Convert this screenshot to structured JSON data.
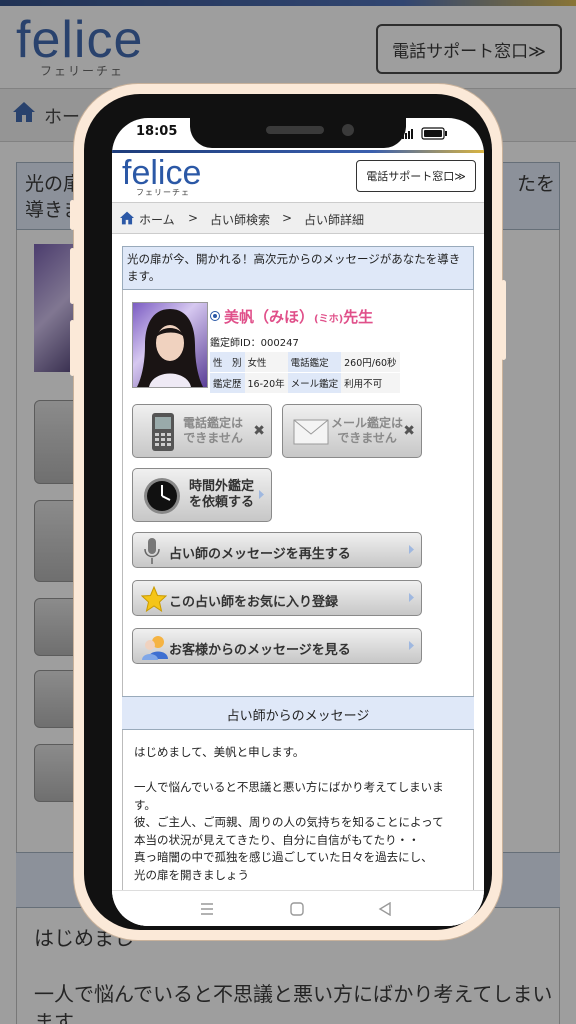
{
  "site": {
    "logo": "felice",
    "logo_sub": "フェリーチェ",
    "support_button": "電話サポート窓口≫"
  },
  "status_bar": {
    "time": "18:05"
  },
  "breadcrumb": {
    "home": "ホーム",
    "sep": ">",
    "search": "占い師検索",
    "detail": "占い師詳細",
    "bg_home": "ホー"
  },
  "intro": "光の扉が今、開かれる！高次元からのメッセージがあなたを導きます。",
  "bg": {
    "intro_left": "光の扉",
    "intro_left2": "導きま",
    "intro_right": "たを",
    "msg_line1": "はじめまし",
    "msg_line2": "一人で悩んでいると不思議と悪い方にばかり考えてしまい",
    "msg_line3": "ます。"
  },
  "profile": {
    "name": "美帆（みほ）",
    "reading": "(ミホ)",
    "title_suffix": "先生",
    "id_label": "鑑定師ID：000247",
    "rows": [
      {
        "k1": "性　別",
        "v1": "女性",
        "k2": "電話鑑定",
        "v2": "260円/60秒"
      },
      {
        "k1": "鑑定歴",
        "v1": "16-20年",
        "k2": "メール鑑定",
        "v2": "利用不可"
      }
    ]
  },
  "buttons": {
    "phone_unavailable": "電話鑑定は\nできません",
    "mail_unavailable": "メール鑑定は\nできません",
    "off_hours_line1": "時間外鑑定",
    "off_hours_line2": "を依頼する",
    "play_message": "占い師のメッセージを再生する",
    "favorite": "この占い師をお気に入り登録",
    "customer_messages": "お客様からのメッセージを見る"
  },
  "message": {
    "heading": "占い師からのメッセージ",
    "paragraphs": [
      "はじめまして、美帆と申します。",
      "一人で悩んでいると不思議と悪い方にばかり考えてしまいます。\n彼、ご主人、ご両親、周りの人の気持ちを知ることによって\n本当の状況が見えてきたり、自分に自信がもてたり・・\n真っ暗闇の中で孤独を感じ過ごしていた日々を過去にし、\n光の扉を開きましょう"
    ]
  },
  "colors": {
    "brand_blue": "#2b58a6",
    "name_pink": "#e0508a",
    "header_bg": "#dfe8f8",
    "phone_frame": "#fbe9d8"
  }
}
